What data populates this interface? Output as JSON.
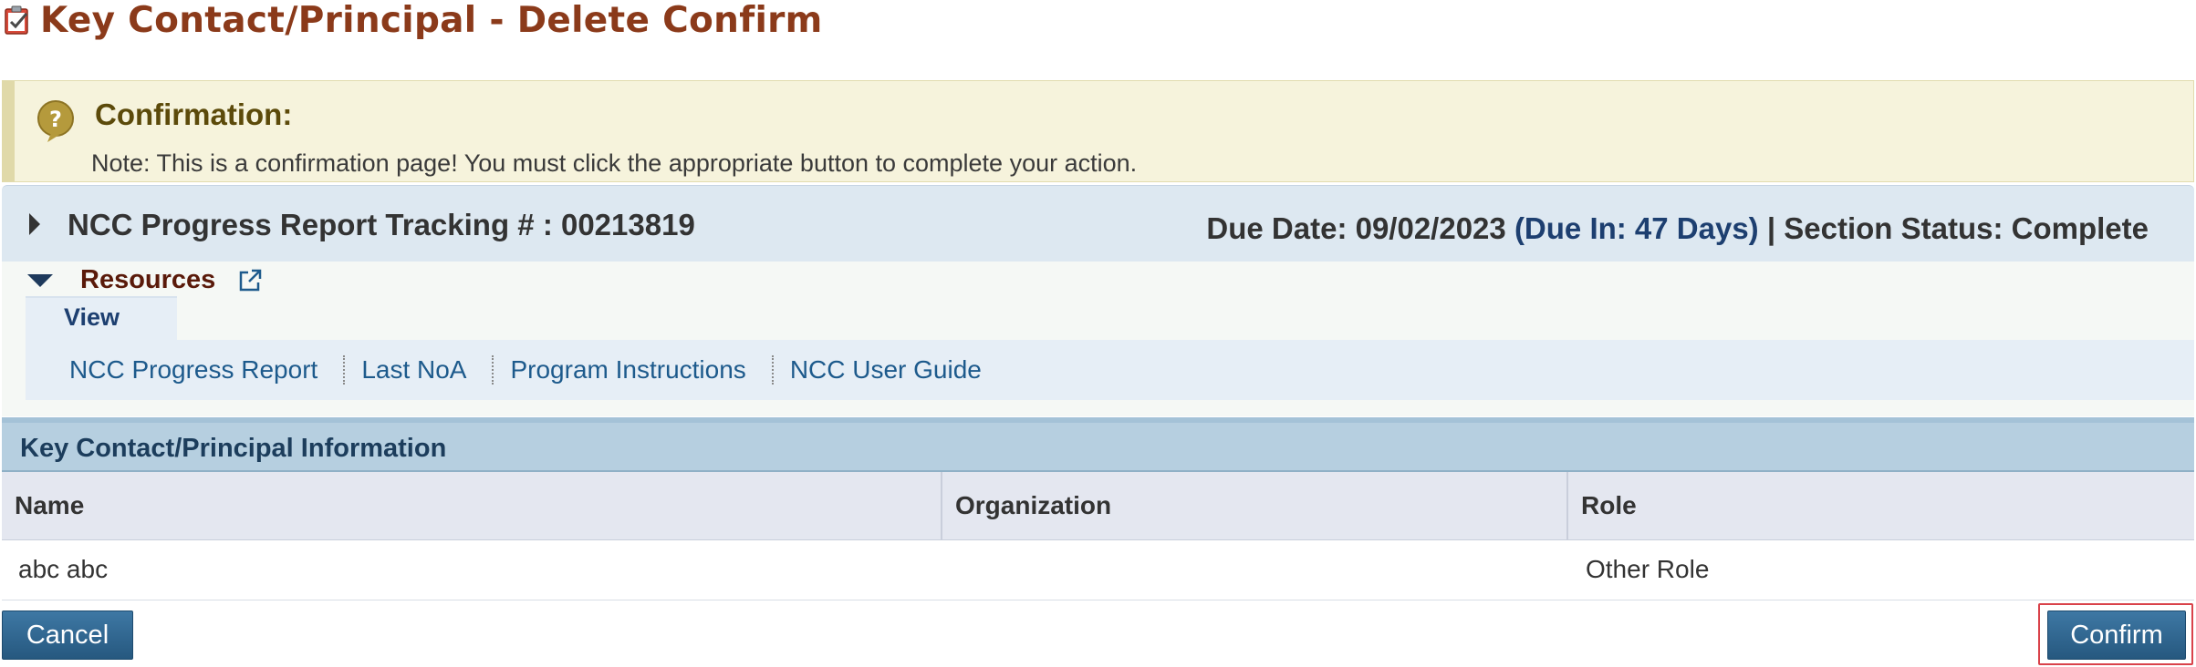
{
  "page": {
    "title": "Key Contact/Principal - Delete Confirm",
    "title_icon": "clipboard-check-icon"
  },
  "confirmation": {
    "icon": "question-bubble-icon",
    "heading": "Confirmation:",
    "note": "Note: This is a confirmation page! You must click the appropriate button to complete your action."
  },
  "tracking": {
    "label": "NCC Progress Report Tracking # : 00213819",
    "due_date": "Due Date: 09/02/2023",
    "due_in": "(Due In: 47 Days)",
    "separator": "|",
    "section_status": "Section Status: Complete"
  },
  "resources": {
    "label": "Resources",
    "tab": "View",
    "links": [
      "NCC Progress Report",
      "Last NoA",
      "Program Instructions",
      "NCC User Guide"
    ]
  },
  "section": {
    "header": "Key Contact/Principal Information",
    "columns": [
      "Name",
      "Organization",
      "Role"
    ],
    "rows": [
      {
        "name": "abc abc",
        "organization": "",
        "role": "Other Role"
      }
    ]
  },
  "actions": {
    "cancel": "Cancel",
    "confirm": "Confirm"
  },
  "colors": {
    "title": "#8b3a1a",
    "confirm_bg": "#f6f3dc",
    "header_bg": "#dde8f1",
    "section_bg": "#b6cfe0",
    "button": "#2e6690",
    "confirm_highlight": "#d9424a"
  }
}
